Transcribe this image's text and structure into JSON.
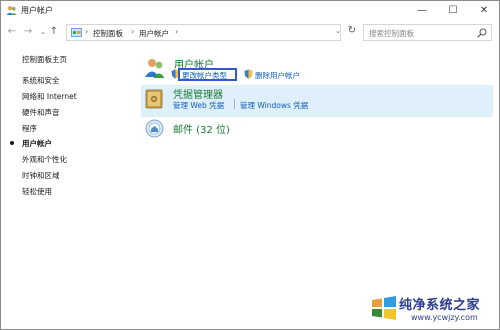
{
  "window": {
    "title": "用户帐户",
    "minimize_glyph": "—",
    "maximize_glyph": "☐",
    "close_glyph": "✕"
  },
  "nav": {
    "back_glyph": "←",
    "forward_glyph": "→",
    "recent_glyph": "⌄",
    "up_glyph": "↑",
    "breadcrumbs": [
      "控制面板",
      "用户帐户"
    ],
    "separator": "›",
    "dropdown_glyph": "⌄",
    "refresh_glyph": "↻",
    "search_placeholder": "搜索控制面板"
  },
  "sidebar": {
    "home": "控制面板主页",
    "items": [
      {
        "label": "系统和安全"
      },
      {
        "label": "网络和 Internet"
      },
      {
        "label": "硬件和声音"
      },
      {
        "label": "程序"
      },
      {
        "label": "用户帐户",
        "active": true
      },
      {
        "label": "外观和个性化"
      },
      {
        "label": "时钟和区域"
      },
      {
        "label": "轻松使用"
      }
    ]
  },
  "main": {
    "user_accounts": {
      "title": "用户帐户",
      "tasks": [
        "更改帐户类型",
        "删除用户帐户"
      ]
    },
    "credential_manager": {
      "title": "凭据管理器",
      "tasks": [
        "管理 Web 凭据",
        "管理 Windows 凭据"
      ]
    },
    "mail": {
      "title": "邮件 (32 位)"
    }
  },
  "watermark": {
    "title": "纯净系统之家",
    "url": "www.ycwjzy.com"
  },
  "colors": {
    "section_title": "#1a7a35",
    "link": "#0d5fbb",
    "highlight_border": "#3557d6",
    "band": "#dff0fb"
  }
}
